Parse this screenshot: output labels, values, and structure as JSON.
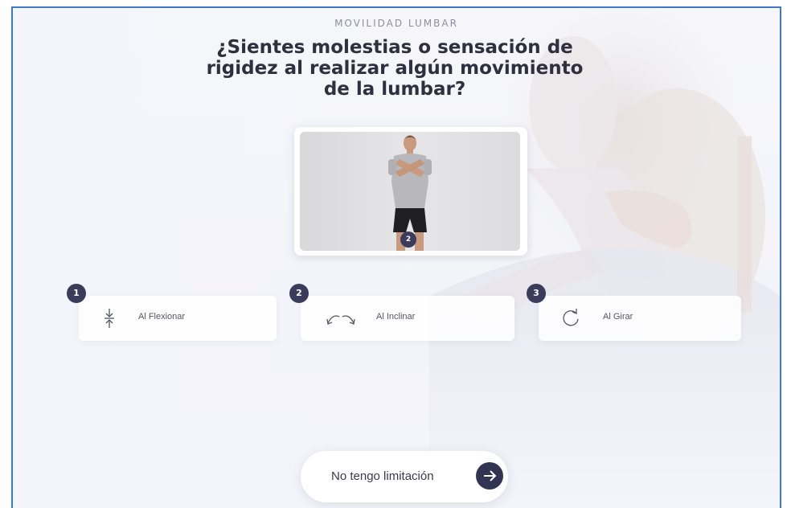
{
  "header": {
    "eyebrow": "MOVILIDAD LUMBAR",
    "title": "¿Sientes molestias o sensación de rigidez al realizar algún movimiento de la lumbar?"
  },
  "video": {
    "badge": "2"
  },
  "options": [
    {
      "number": "1",
      "label": "Al Flexionar",
      "icon": "flexion-icon"
    },
    {
      "number": "2",
      "label": "Al Inclinar",
      "icon": "inclination-icon"
    },
    {
      "number": "3",
      "label": "Al Girar",
      "icon": "rotation-icon"
    }
  ],
  "footer": {
    "button_label": "No tengo limitación",
    "button_icon": "arrow-right-icon"
  },
  "colors": {
    "accent": "#333352",
    "border": "#3f78c4"
  }
}
